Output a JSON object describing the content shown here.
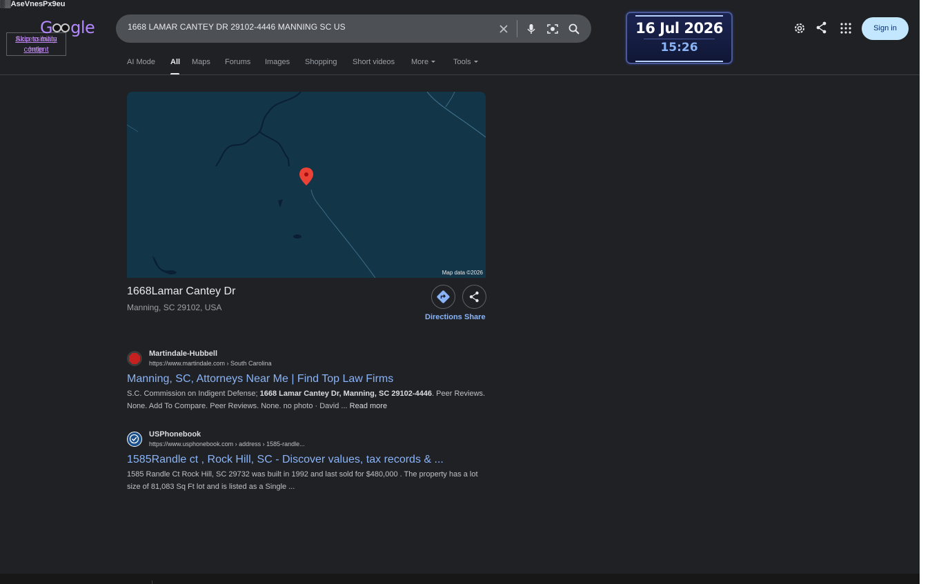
{
  "debug_overlay": {
    "garbled_text": "░▒AseVnesPx9eu",
    "skip_links": [
      "Skip to main",
      "content",
      "Accessibility",
      "help"
    ]
  },
  "logo": {
    "text_left": "G",
    "text_right": "gle"
  },
  "search": {
    "query": "1668 LAMAR CANTEY DR 29102-4446 MANNING SC US",
    "icons": [
      "close-icon",
      "mic-icon",
      "lens-icon",
      "search-icon"
    ]
  },
  "clock": {
    "date": "16 Jul 2026",
    "time": "15:26"
  },
  "header": {
    "icons": [
      "gear-icon",
      "share-icon",
      "apps-grid-icon"
    ],
    "sign_in": "Sign in"
  },
  "tabs": [
    {
      "label": "AI Mode"
    },
    {
      "label": "All"
    },
    {
      "label": "Maps"
    },
    {
      "label": "Forums"
    },
    {
      "label": "Images"
    },
    {
      "label": "Shopping"
    },
    {
      "label": "Short videos"
    },
    {
      "label": "More"
    },
    {
      "label": "Tools"
    }
  ],
  "place": {
    "map_attribution": "Map data ©2026",
    "title": "1668Lamar Cantey Dr",
    "subtitle": "Manning, SC 29102, USA",
    "directions_label": "Directions",
    "share_label": "Share"
  },
  "results": [
    {
      "site": "Martindale-Hubbell",
      "url": "https://www.martindale.com › South Carolina",
      "title": "Manning, SC, Attorneys  Near Me | Find Top Law Firms",
      "snippet_pre": "S.C. Commission on Indigent Defense; ",
      "snippet_bold": "1668 Lamar Cantey Dr, Manning, SC 29102-4446",
      "snippet_post": ". Peer Reviews. None. Add To Compare. Peer Reviews. None. no photo · David ...  ",
      "read_more": "Read more",
      "favicon_color": "#c5221f"
    },
    {
      "site": "USPhonebook",
      "url": "https://www.usphonebook.com › address › 1585-randle...",
      "title": "1585Randle ct , Rock Hill, SC -  Discover values, tax records  & ...",
      "snippet": "1585 Randle Ct Rock Hill, SC 29732 was built in 1992 and last sold for $480,000 . The property has a lot size of 81,083 Sq Ft lot and is listed as a Single ...",
      "favicon_color": "#1a4f8a"
    }
  ]
}
